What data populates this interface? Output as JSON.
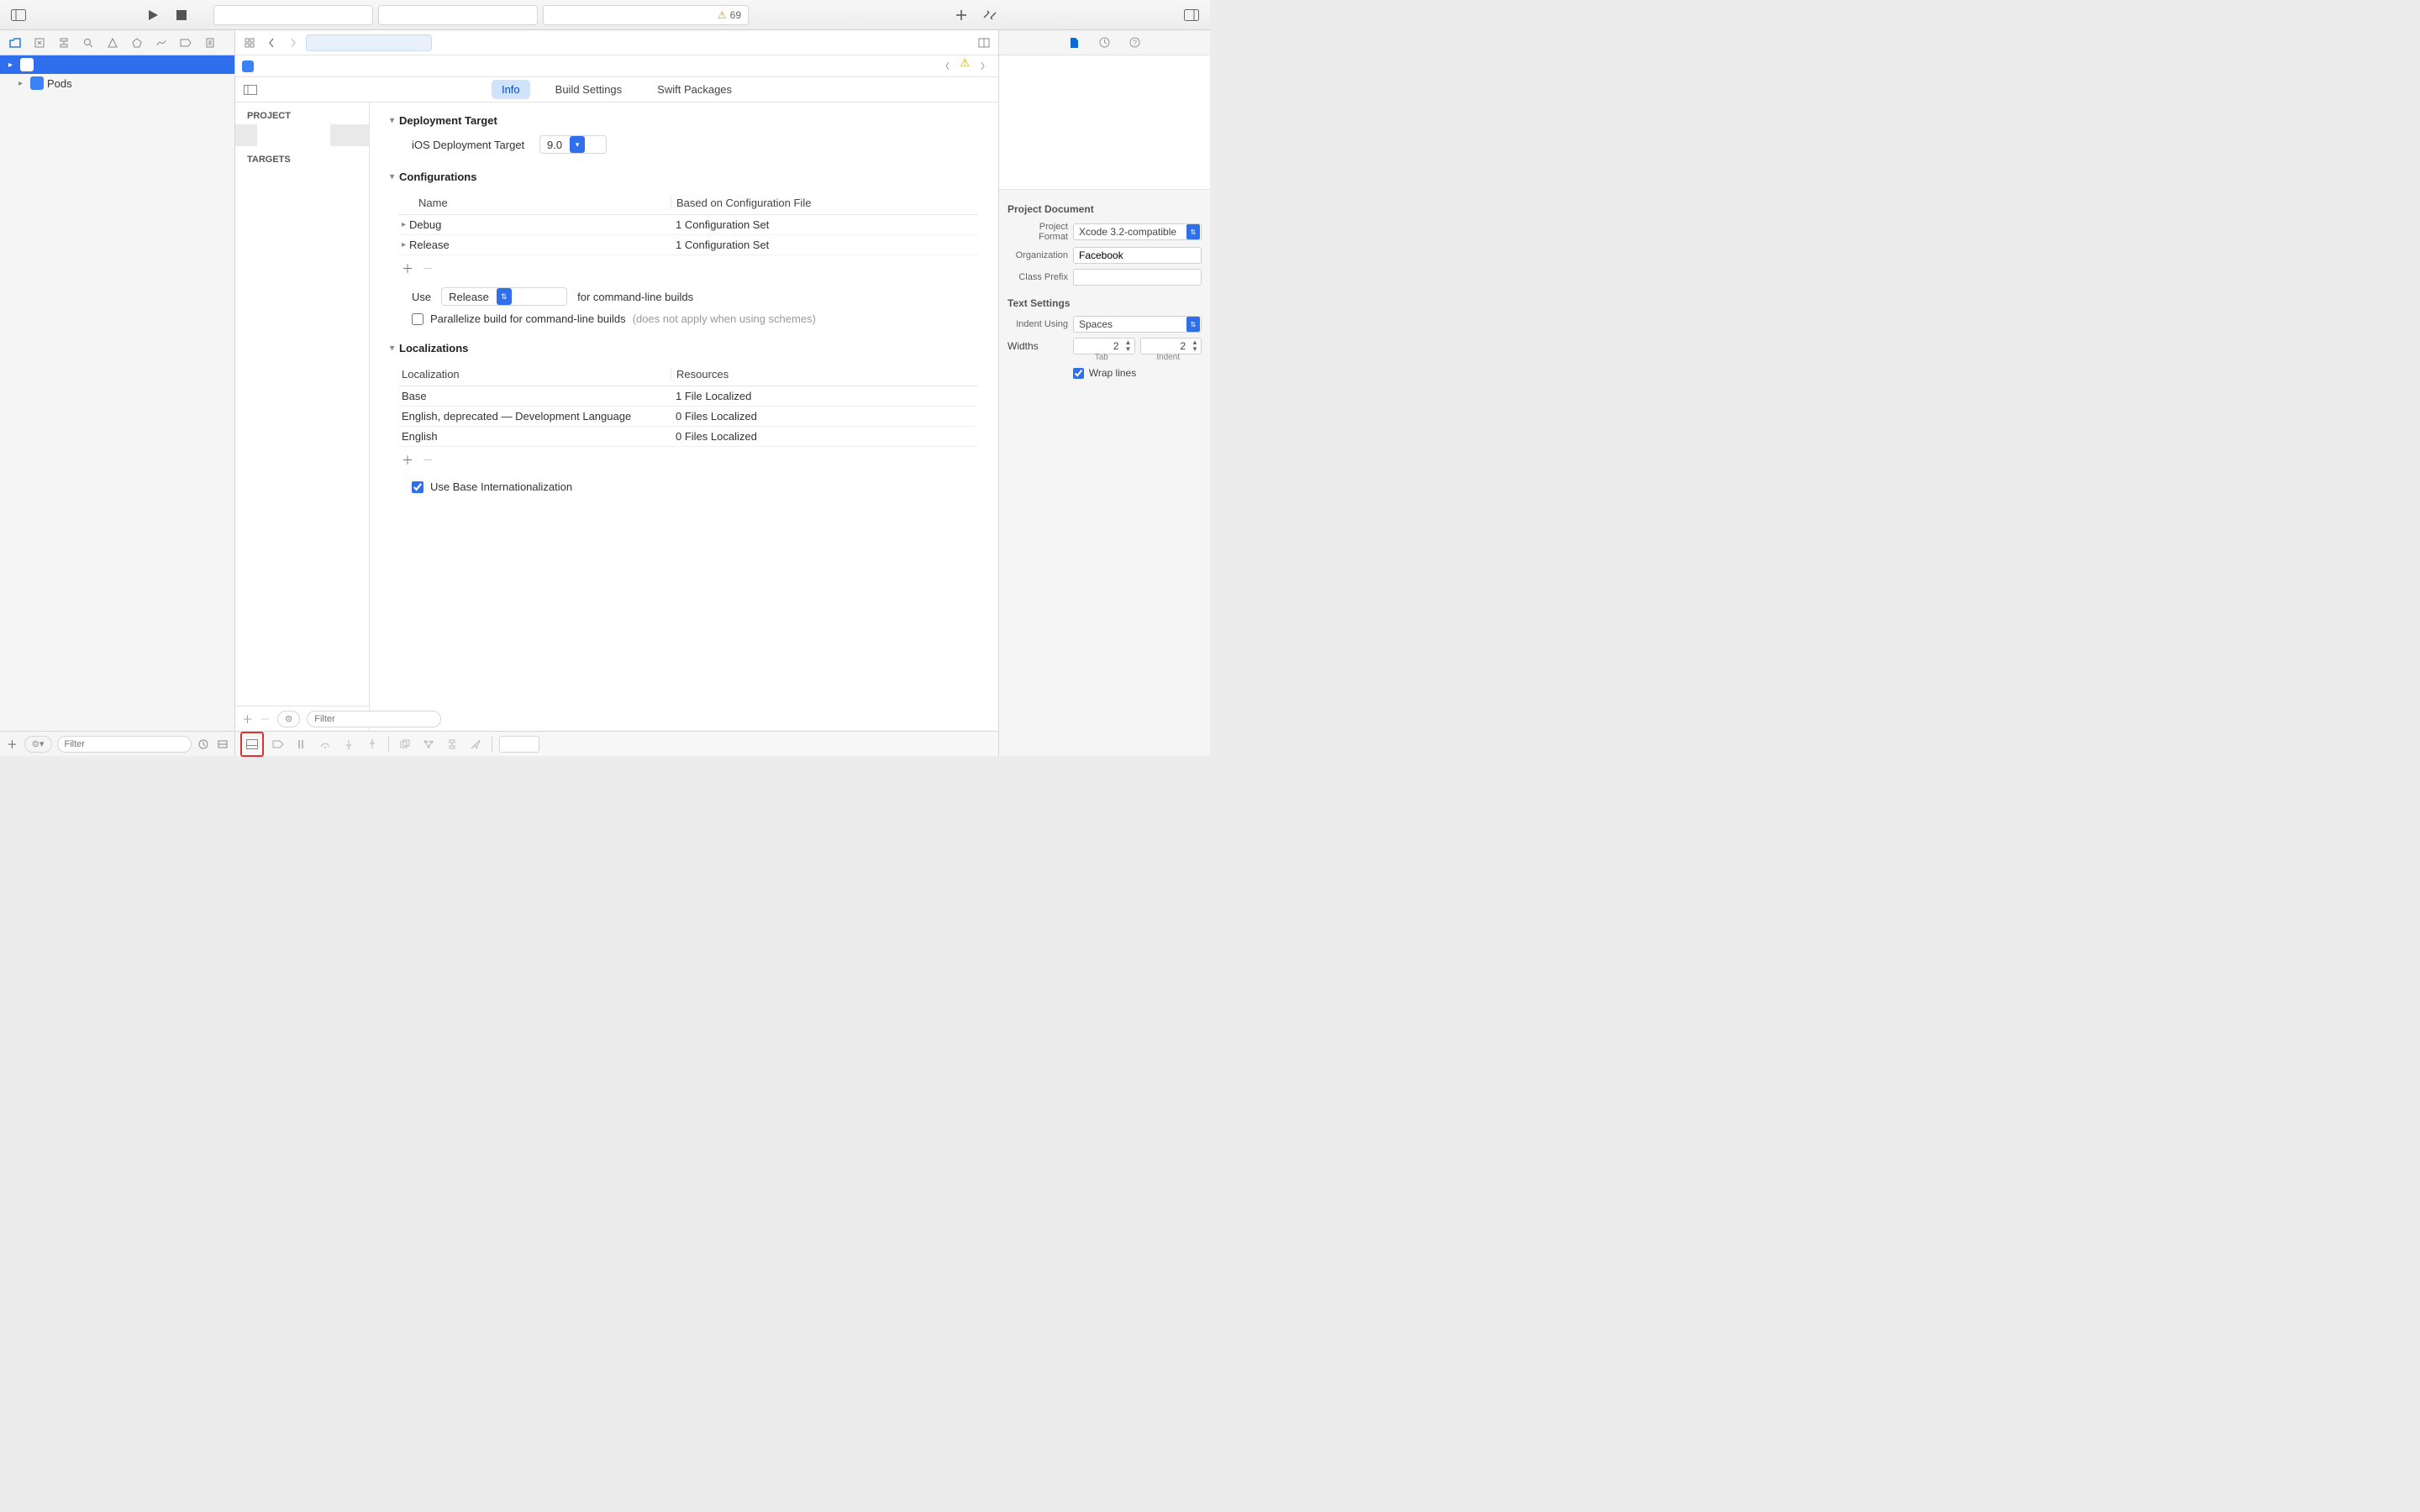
{
  "toolbar": {
    "warning_count": "69"
  },
  "navigator": {
    "project_name": "",
    "pods": "Pods",
    "filter_placeholder": "Filter"
  },
  "editor_tabs": {
    "info": "Info",
    "build_settings": "Build Settings",
    "swift_packages": "Swift Packages"
  },
  "targets_panel": {
    "project_label": "PROJECT",
    "targets_label": "TARGETS",
    "filter_placeholder": "Filter"
  },
  "deployment": {
    "header": "Deployment Target",
    "ios_label": "iOS Deployment Target",
    "ios_value": "9.0"
  },
  "configurations": {
    "header": "Configurations",
    "col_name": "Name",
    "col_based": "Based on Configuration File",
    "rows": [
      {
        "name": "Debug",
        "based": "1 Configuration Set"
      },
      {
        "name": "Release",
        "based": "1 Configuration Set"
      }
    ],
    "use_label": "Use",
    "use_value": "Release",
    "use_suffix": "for command-line builds",
    "parallelize_label": "Parallelize build for command-line builds",
    "parallelize_note": "(does not apply when using schemes)"
  },
  "localizations": {
    "header": "Localizations",
    "col_loc": "Localization",
    "col_res": "Resources",
    "rows": [
      {
        "loc": "Base",
        "res": "1 File Localized"
      },
      {
        "loc": "English, deprecated — Development Language",
        "res": "0 Files Localized"
      },
      {
        "loc": "English",
        "res": "0 Files Localized"
      }
    ],
    "use_base_label": "Use Base Internationalization"
  },
  "inspector": {
    "doc_header": "Project Document",
    "format_label": "Project Format",
    "format_value": "Xcode 3.2-compatible",
    "org_label": "Organization",
    "org_value": "Facebook",
    "prefix_label": "Class Prefix",
    "prefix_value": "",
    "text_header": "Text Settings",
    "indent_using_label": "Indent Using",
    "indent_using_value": "Spaces",
    "widths_label": "Widths",
    "tab_value": "2",
    "indent_value": "2",
    "tab_caption": "Tab",
    "indent_caption": "Indent",
    "wrap_label": "Wrap lines"
  }
}
